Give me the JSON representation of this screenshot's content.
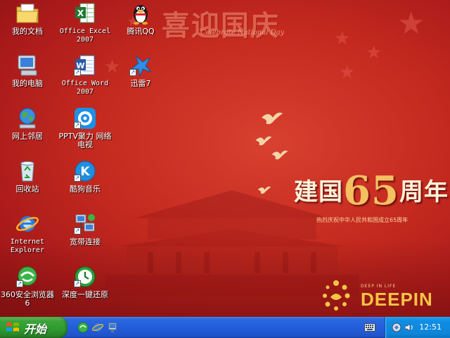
{
  "desktop": {
    "icons": [
      {
        "name": "my-documents",
        "label": "我的文档"
      },
      {
        "name": "office-excel",
        "label": "Office Excel 2007"
      },
      {
        "name": "tencent-qq",
        "label": "腾讯QQ"
      },
      {
        "name": "my-computer",
        "label": "我的电脑"
      },
      {
        "name": "office-word",
        "label": "Office Word 2007"
      },
      {
        "name": "xunlei",
        "label": "迅雷7"
      },
      {
        "name": "network-places",
        "label": "网上邻居"
      },
      {
        "name": "pptv",
        "label": "PPTV聚力 网络电视"
      },
      {
        "name": "recycle-bin",
        "label": "回收站"
      },
      {
        "name": "kugou",
        "label": "酷狗音乐"
      },
      {
        "name": "internet-explorer",
        "label": "Internet Explorer"
      },
      {
        "name": "broadband",
        "label": "宽带连接"
      },
      {
        "name": "browser-360",
        "label": "360安全浏览器6"
      },
      {
        "name": "deepin-restore",
        "label": "深度一键还原"
      }
    ]
  },
  "wallpaper": {
    "headline": "喜迎国庆",
    "headline_sub": "Celebrate National Day",
    "anniv_prefix": "建国",
    "anniv_number": "65",
    "anniv_suffix": "周年",
    "anniv_sub": "热烈庆祝中华人民共和国成立65周年",
    "brand_small": "DEEP IN LIFE",
    "brand": "DEEPIN"
  },
  "taskbar": {
    "start_label": "开始",
    "clock": "12:51"
  },
  "colors": {
    "wallpaper_red": "#c52a1f",
    "taskbar_blue": "#245ddb",
    "start_green": "#2f9a2f",
    "tray_blue": "#0d85d8",
    "brand_gold": "#f7c545"
  }
}
